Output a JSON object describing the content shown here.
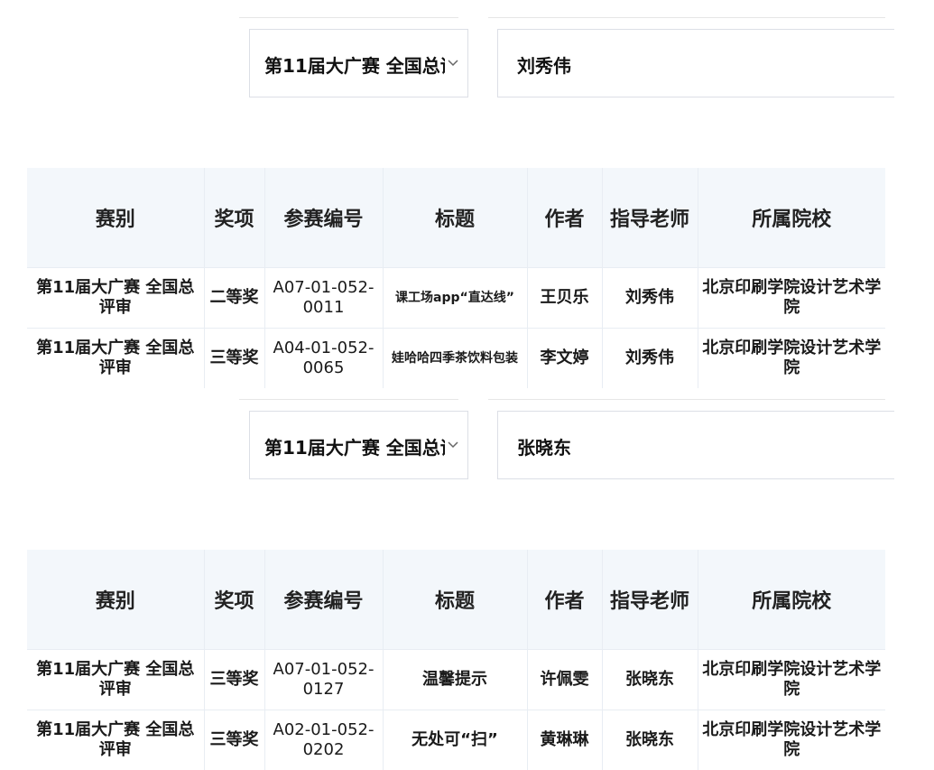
{
  "blocks": [
    {
      "competition": "第11届大广赛 全国总评审",
      "teacher": "刘秀伟",
      "headers": [
        "赛别",
        "奖项",
        "参赛编号",
        "标题",
        "作者",
        "指导老师",
        "所属院校"
      ],
      "rows": [
        [
          "第11届大广赛 全国总评审",
          "二等奖",
          "A07-01-052-0011",
          "课工场app“直达线”",
          "王贝乐",
          "刘秀伟",
          "北京印刷学院设计艺术学院"
        ],
        [
          "第11届大广赛 全国总评审",
          "三等奖",
          "A04-01-052-0065",
          "娃哈哈四季茶饮料包装",
          "李文婷",
          "刘秀伟",
          "北京印刷学院设计艺术学院"
        ]
      ]
    },
    {
      "competition": "第11届大广赛 全国总评审",
      "teacher": "张晓东",
      "headers": [
        "赛别",
        "奖项",
        "参赛编号",
        "标题",
        "作者",
        "指导老师",
        "所属院校"
      ],
      "rows": [
        [
          "第11届大广赛 全国总评审",
          "三等奖",
          "A07-01-052-0127",
          "温馨提示",
          "许佩雯",
          "张晓东",
          "北京印刷学院设计艺术学院"
        ],
        [
          "第11届大广赛 全国总评审",
          "三等奖",
          "A02-01-052-0202",
          "无处可“扫”",
          "黄琳琳",
          "张晓东",
          "北京印刷学院设计艺术学院"
        ]
      ]
    }
  ],
  "icons": {
    "dropdown": "chevron-down-icon"
  },
  "colors": {
    "header_bg": "#f3f7fb",
    "border": "#dcdfe6"
  }
}
